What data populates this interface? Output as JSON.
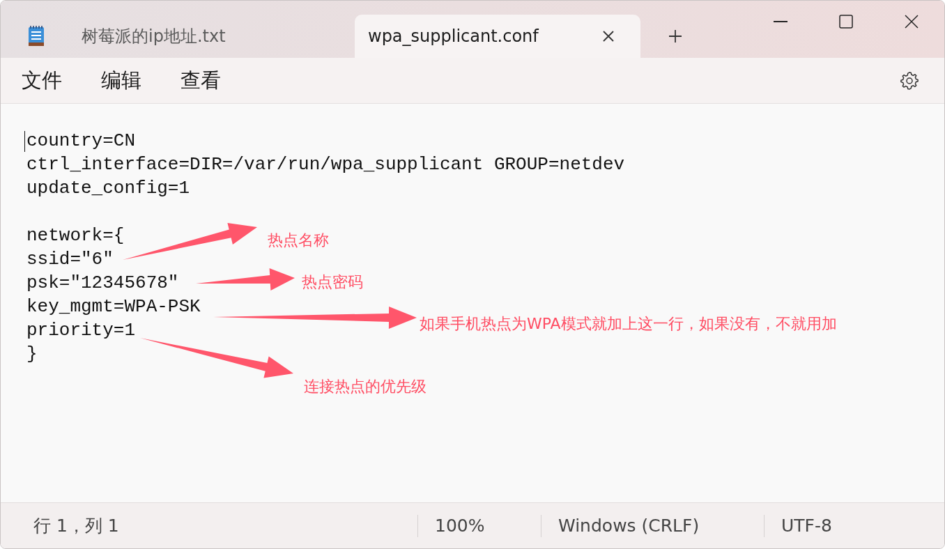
{
  "tabs": [
    {
      "label": "树莓派的ip地址.txt",
      "selected": false
    },
    {
      "label": "wpa_supplicant.conf",
      "selected": true
    }
  ],
  "menu": [
    "文件",
    "编辑",
    "查看"
  ],
  "editor": {
    "blocks": [
      [
        "country=CN",
        "ctrl_interface=DIR=/var/run/wpa_supplicant GROUP=netdev",
        "update_config=1"
      ],
      [
        "network={",
        "ssid=\"6\"",
        "psk=\"12345678\"",
        "key_mgmt=WPA-PSK",
        "priority=1",
        "}"
      ]
    ]
  },
  "annotations": [
    {
      "text": "热点名称"
    },
    {
      "text": "热点密码"
    },
    {
      "text": "如果手机热点为WPA模式就加上这一行，如果没有，不就用加"
    },
    {
      "text": "连接热点的优先级"
    }
  ],
  "status_bar": {
    "position": "行 1，列 1",
    "zoom": "100%",
    "line_ending": "Windows (CRLF)",
    "encoding": "UTF-8"
  }
}
